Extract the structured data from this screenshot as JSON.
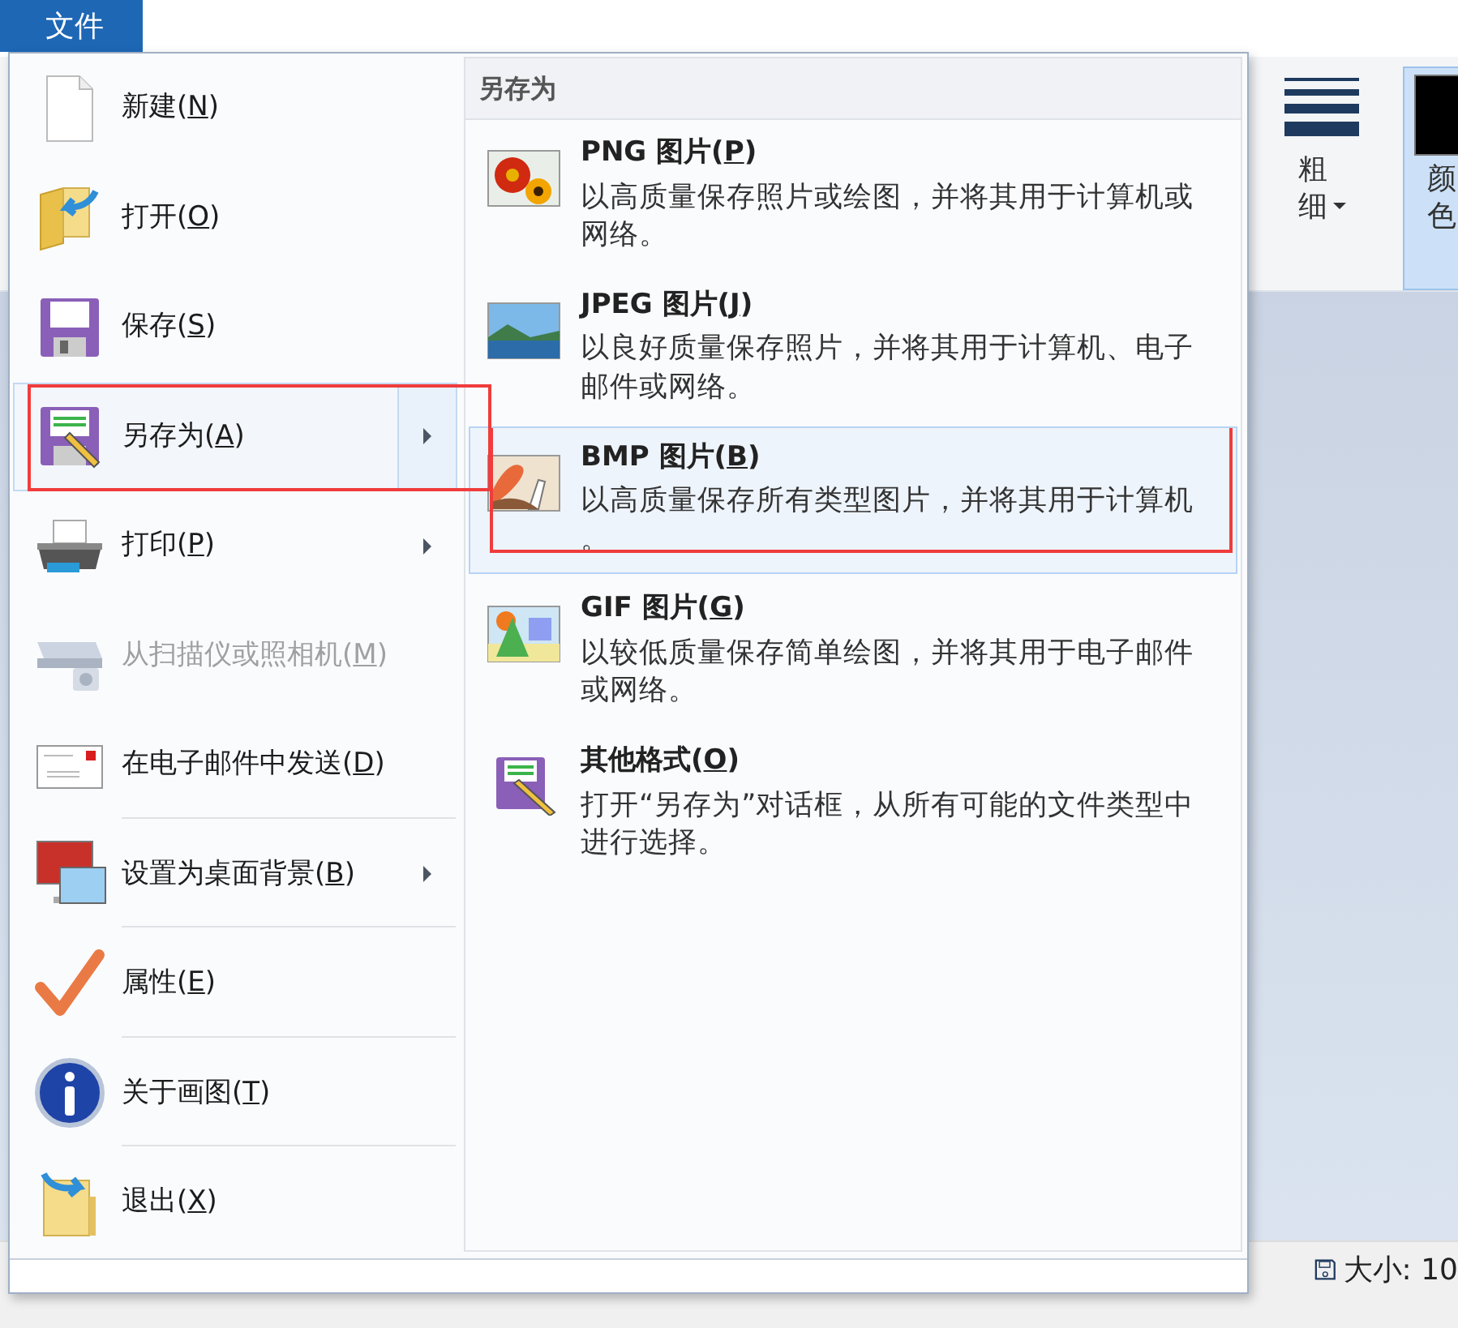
{
  "file_tab": {
    "label": "文件",
    "selected": true
  },
  "menu": {
    "items": [
      {
        "before": "新建(",
        "key": "N",
        "after": ")",
        "disabled": false,
        "submenu": false,
        "selected": false,
        "divider_below": false,
        "annotated": false
      },
      {
        "before": "打开(",
        "key": "O",
        "after": ")",
        "disabled": false,
        "submenu": false,
        "selected": false,
        "divider_below": false,
        "annotated": false
      },
      {
        "before": "保存(",
        "key": "S",
        "after": ")",
        "disabled": false,
        "submenu": false,
        "selected": false,
        "divider_below": false,
        "annotated": false
      },
      {
        "before": "另存为(",
        "key": "A",
        "after": ")",
        "disabled": false,
        "submenu": true,
        "selected": true,
        "divider_below": false,
        "annotated": true
      },
      {
        "before": "打印(",
        "key": "P",
        "after": ")",
        "disabled": false,
        "submenu": true,
        "selected": false,
        "divider_below": false,
        "annotated": false
      },
      {
        "before": "从扫描仪或照相机(",
        "key": "M",
        "after": ")",
        "disabled": true,
        "submenu": false,
        "selected": false,
        "divider_below": false,
        "annotated": false
      },
      {
        "before": "在电子邮件中发送(",
        "key": "D",
        "after": ")",
        "disabled": false,
        "submenu": false,
        "selected": false,
        "divider_below": true,
        "annotated": false
      },
      {
        "before": "设置为桌面背景(",
        "key": "B",
        "after": ")",
        "disabled": false,
        "submenu": true,
        "selected": false,
        "divider_below": true,
        "annotated": false
      },
      {
        "before": "属性(",
        "key": "E",
        "after": ")",
        "disabled": false,
        "submenu": false,
        "selected": false,
        "divider_below": true,
        "annotated": false
      },
      {
        "before": "关于画图(",
        "key": "T",
        "after": ")",
        "disabled": false,
        "submenu": false,
        "selected": false,
        "divider_below": true,
        "annotated": false
      },
      {
        "before": "退出(",
        "key": "X",
        "after": ")",
        "disabled": false,
        "submenu": false,
        "selected": false,
        "divider_below": false,
        "annotated": false
      }
    ]
  },
  "submenu": {
    "title": "另存为",
    "items": [
      {
        "before": "PNG 图片(",
        "key": "P",
        "after": ")",
        "description": "以高质量保存照片或绘图，并将其用于计算机或网络。",
        "selected": false,
        "annotated": false
      },
      {
        "before": "JPEG 图片(",
        "key": "J",
        "after": ")",
        "description": "以良好质量保存照片，并将其用于计算机、电子邮件或网络。",
        "selected": false,
        "annotated": false
      },
      {
        "before": "BMP 图片(",
        "key": "B",
        "after": ")",
        "description": "以高质量保存所有类型图片，并将其用于计算机。",
        "selected": true,
        "annotated": true
      },
      {
        "before": "GIF 图片(",
        "key": "G",
        "after": ")",
        "description": "以较低质量保存简单绘图，并将其用于电子邮件或网络。",
        "selected": false,
        "annotated": false
      },
      {
        "before": "其他格式(",
        "key": "O",
        "after": ")",
        "description": "打开“另存为”对话框，从所有可能的文件类型中进行选择。",
        "selected": false,
        "annotated": false
      }
    ]
  },
  "ribbon": {
    "buttons": [
      {
        "label": "粗细",
        "dropdown": true,
        "selected": false
      },
      {
        "label": "颜色",
        "dropdown": false,
        "selected": true
      }
    ]
  },
  "status_bar": {
    "size": "大小: 10"
  }
}
